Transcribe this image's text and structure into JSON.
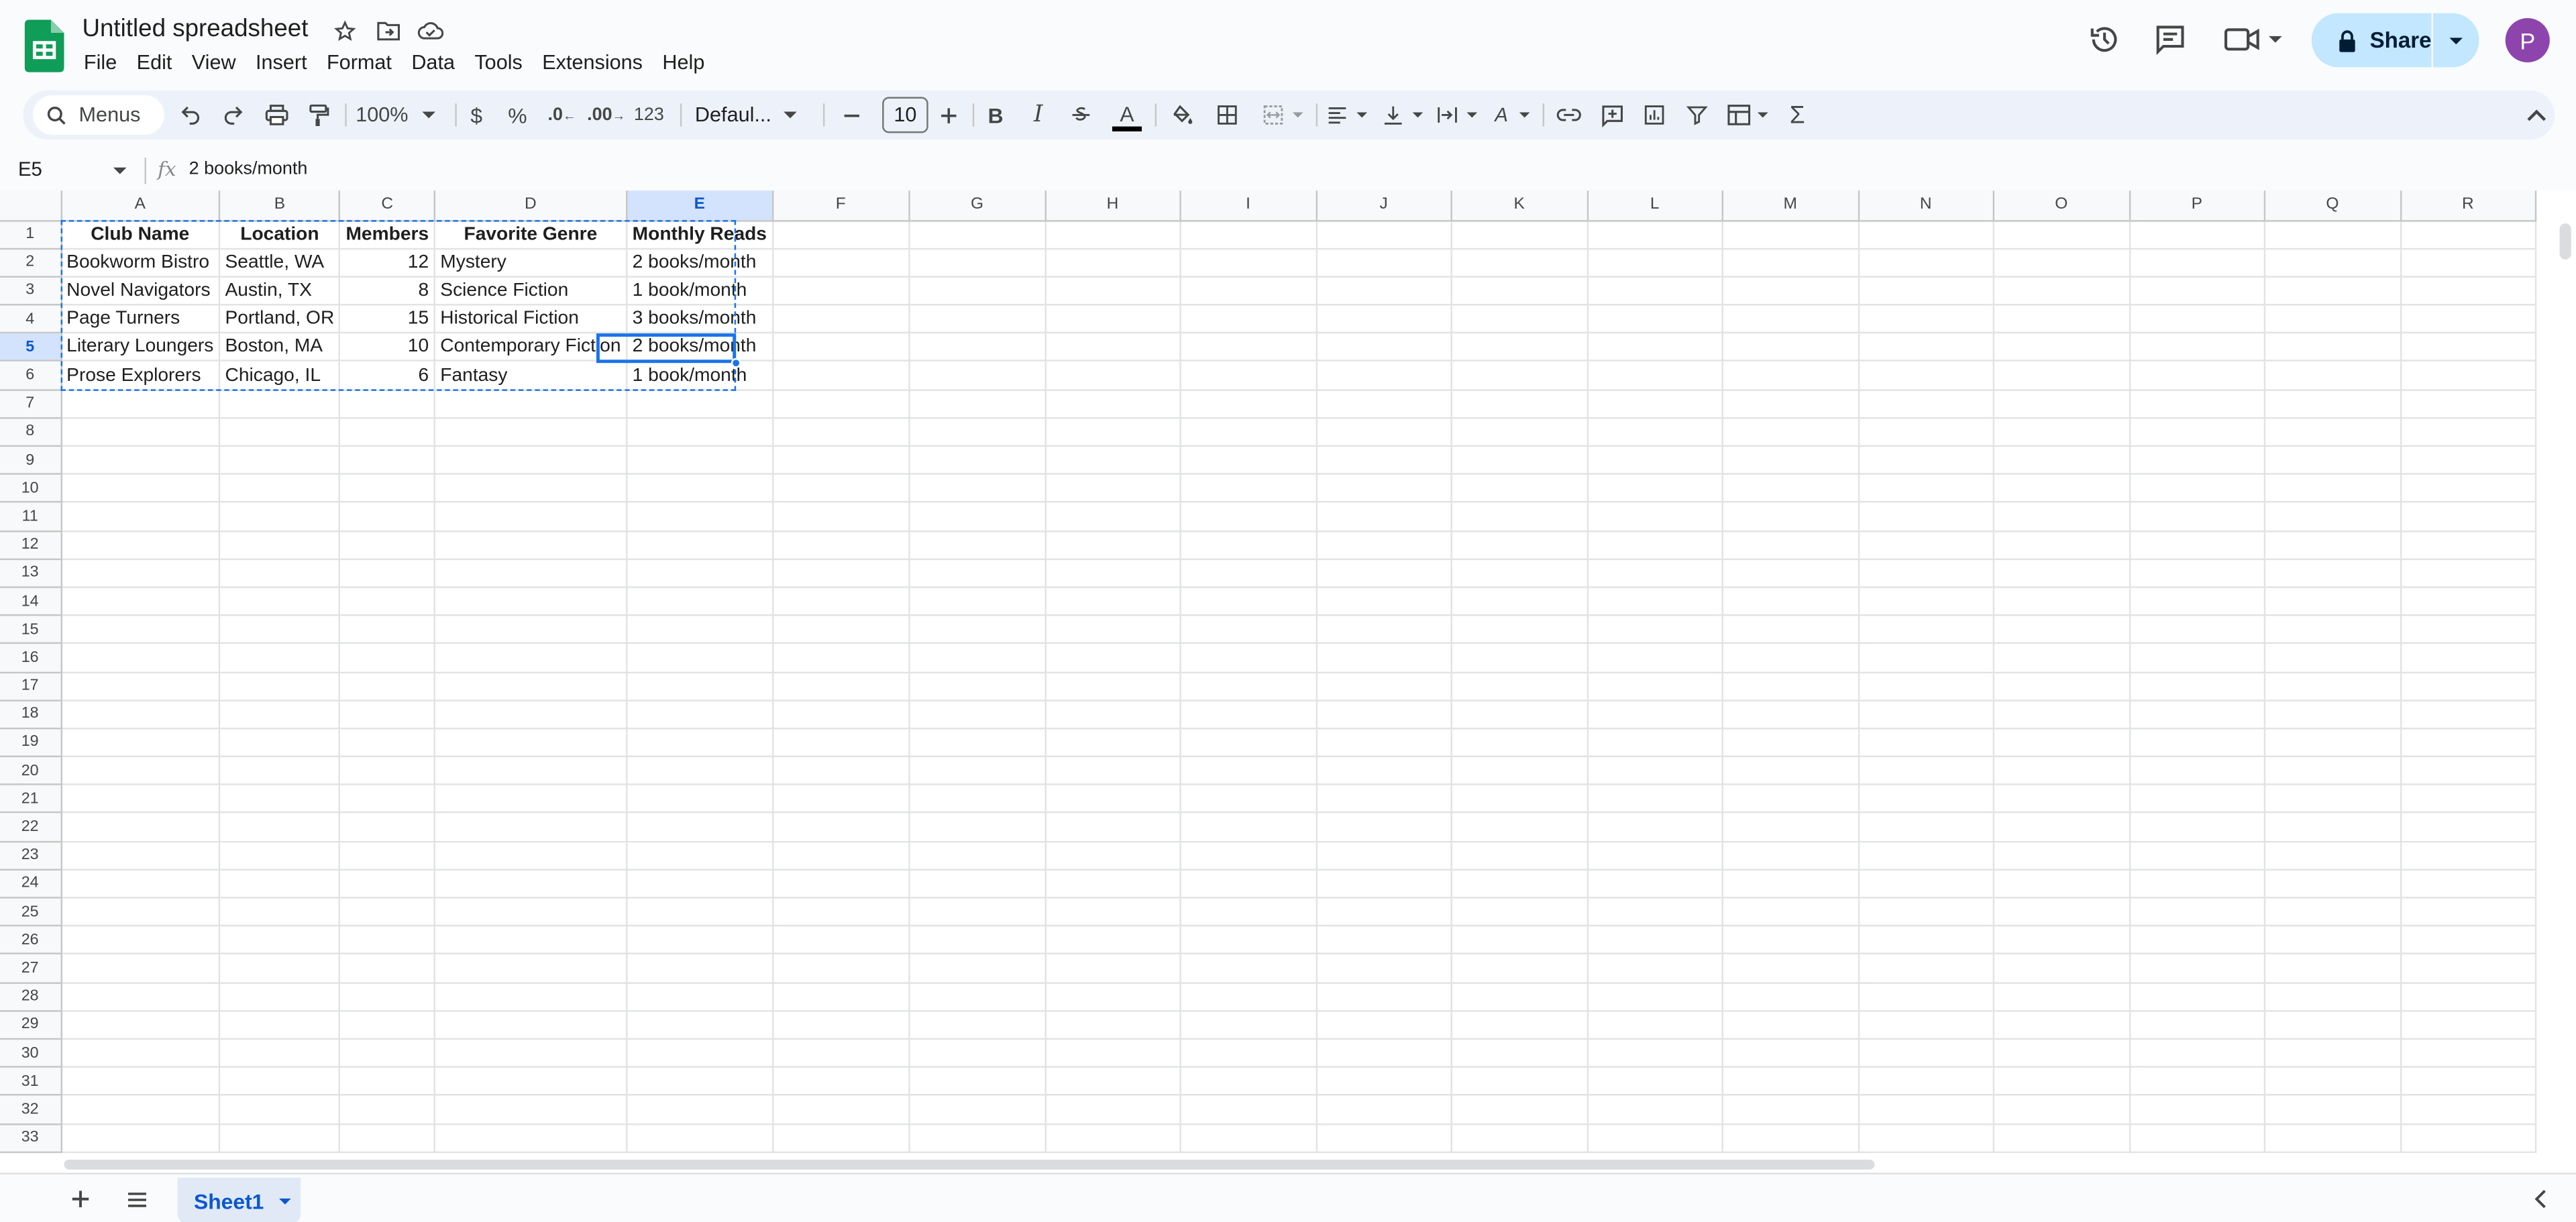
{
  "app": {
    "title": "Untitled spreadsheet",
    "menu": [
      "File",
      "Edit",
      "View",
      "Insert",
      "Format",
      "Data",
      "Tools",
      "Extensions",
      "Help"
    ],
    "share_label": "Share",
    "avatar_initial": "P",
    "colors": {
      "accent": "#1a73e8",
      "share_bg": "#c2e7ff",
      "logo_green": "#0f9d58"
    }
  },
  "toolbar": {
    "search_label": "Menus",
    "zoom": "100%",
    "currency": "$",
    "percent": "%",
    "dec_decrease": ".0",
    "dec_increase": ".00",
    "number_format": "123",
    "font": "Defaul...",
    "font_size": "10",
    "icons": [
      "search-icon",
      "undo-icon",
      "redo-icon",
      "print-icon",
      "paint-format-icon",
      "bold-icon",
      "italic-icon",
      "strikethrough-icon",
      "text-color-icon",
      "fill-color-icon",
      "borders-icon",
      "merge-icon",
      "align-icon",
      "valign-icon",
      "wrap-icon",
      "rotate-icon",
      "link-icon",
      "comment-icon",
      "chart-icon",
      "filter-icon",
      "table-view-icon",
      "functions-icon"
    ]
  },
  "formula_bar": {
    "name_box": "E5",
    "fx": "fx",
    "content": "2 books/month"
  },
  "grid": {
    "columns": [
      "A",
      "B",
      "C",
      "D",
      "E",
      "F",
      "G",
      "H",
      "I",
      "J",
      "K",
      "L",
      "M",
      "N",
      "O",
      "P",
      "Q",
      "R"
    ],
    "selected_column": "E",
    "selected_row": "5",
    "rows": [
      [
        "Club Name",
        "Location",
        "Members",
        "Favorite Genre",
        "Monthly Reads"
      ],
      [
        "Bookworm Bistro",
        "Seattle, WA",
        "12",
        "Mystery",
        "2 books/month"
      ],
      [
        "Novel Navigators",
        "Austin, TX",
        "8",
        "Science Fiction",
        "1 book/month"
      ],
      [
        "Page Turners",
        "Portland, OR",
        "15",
        "Historical Fiction",
        "3 books/month"
      ],
      [
        "Literary Loungers",
        "Boston, MA",
        "10",
        "Contemporary Fiction",
        "2 books/month"
      ],
      [
        "Prose Explorers",
        "Chicago, IL",
        "6",
        "Fantasy",
        "1 book/month"
      ]
    ],
    "row_count": 33
  },
  "sheets": {
    "tabs": [
      "Sheet1"
    ]
  }
}
